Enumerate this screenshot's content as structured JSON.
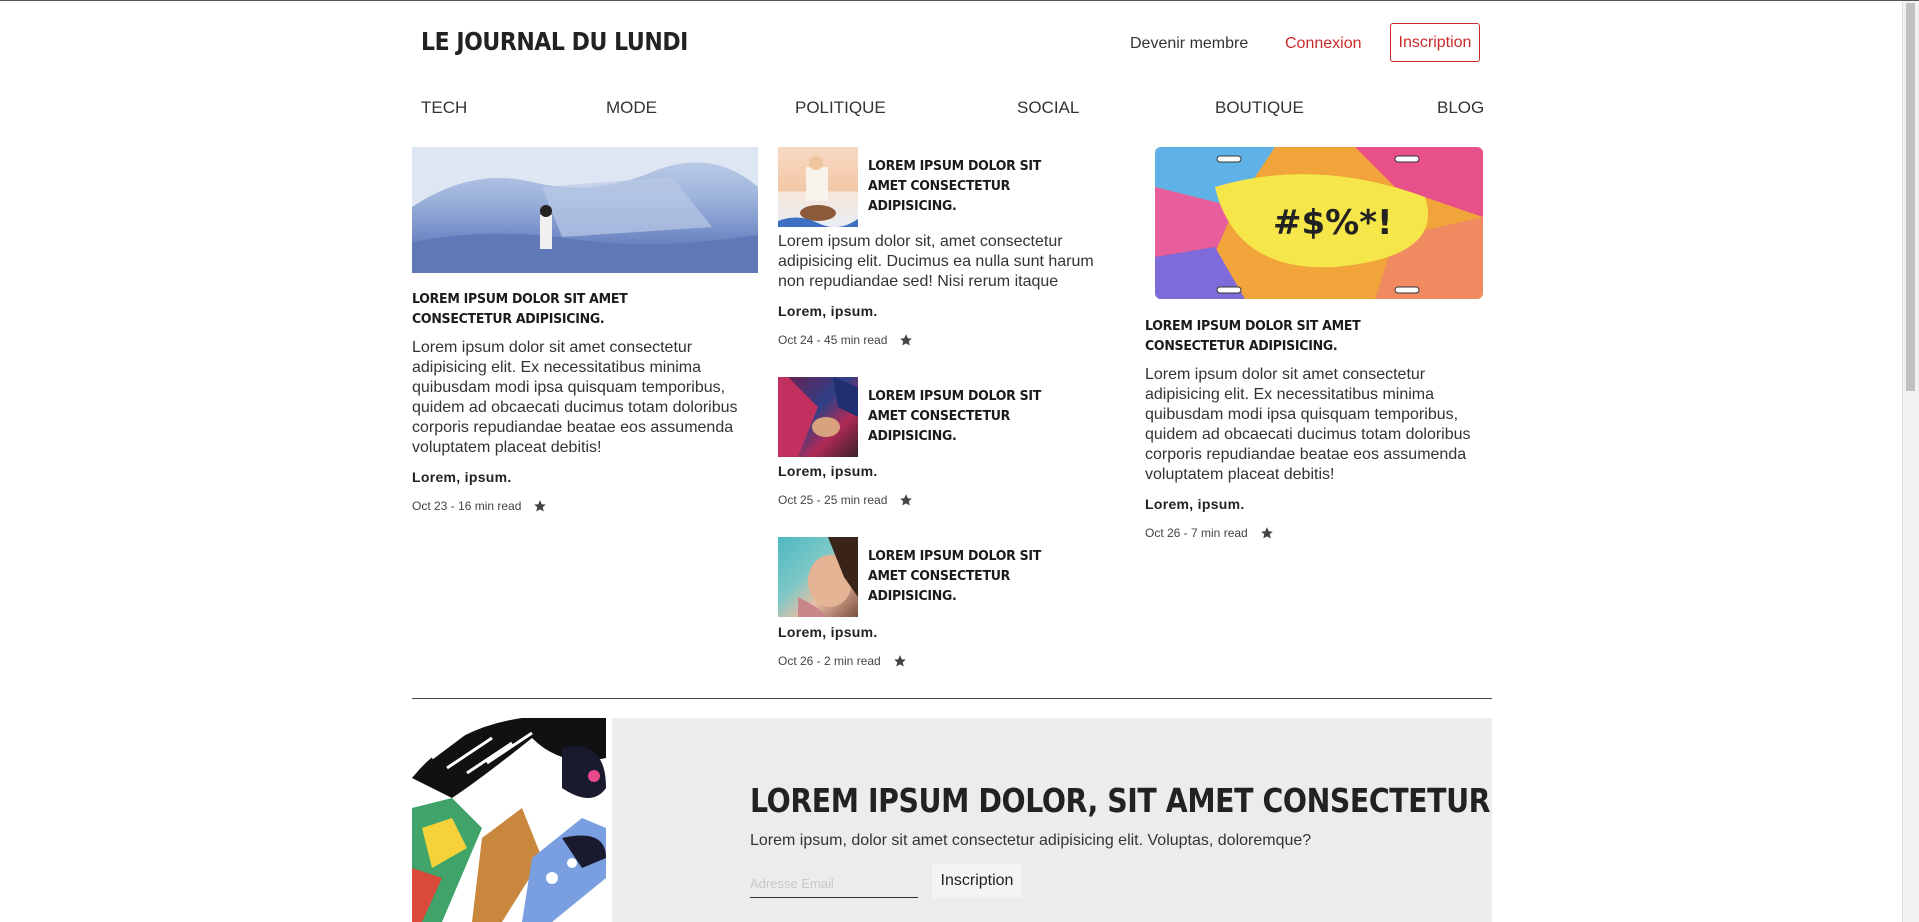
{
  "header": {
    "brand": "LE JOURNAL DU LUNDI",
    "member_link": "Devenir membre",
    "login_link": "Connexion",
    "signup_button": "Inscription"
  },
  "nav": [
    "TECH",
    "MODE",
    "POLITIQUE",
    "SOCIAL",
    "BOUTIQUE",
    "BLOG"
  ],
  "articles": {
    "left": {
      "title": "Lorem ipsum dolor sit amet consectetur adipisicing.",
      "excerpt": "Lorem ipsum dolor sit amet consectetur adipisicing elit. Ex necessitatibus minima quibusdam modi ipsa quisquam temporibus, quidem ad obcaecati ducimus totam doloribus corporis repudiandae beatae eos assumenda voluptatem placeat debitis!",
      "author": "Lorem, ipsum.",
      "meta": "Oct 23 - 16 min read"
    },
    "middle": [
      {
        "title": "Lorem ipsum dolor sit amet consectetur adipisicing.",
        "excerpt": "Lorem ipsum dolor sit, amet consectetur adipisicing elit. Ducimus ea nulla sunt harum non repudiandae sed! Nisi rerum itaque",
        "author": "Lorem, ipsum.",
        "meta": "Oct 24 - 45 min read"
      },
      {
        "title": "Lorem ipsum dolor sit amet consectetur adipisicing.",
        "author": "Lorem, ipsum.",
        "meta": "Oct 25 - 25 min read"
      },
      {
        "title": "Lorem ipsum dolor sit amet consectetur adipisicing.",
        "author": "Lorem, ipsum.",
        "meta": "Oct 26 - 2 min read"
      }
    ],
    "right": {
      "title": "Lorem ipsum dolor sit amet consectetur adipisicing.",
      "excerpt": "Lorem ipsum dolor sit amet consectetur adipisicing elit. Ex necessitatibus minima quibusdam modi ipsa quisquam temporibus, quidem ad obcaecati ducimus totam doloribus corporis repudiandae beatae eos assumenda voluptatem placeat debitis!",
      "author": "Lorem, ipsum.",
      "meta": "Oct 26 - 7 min read",
      "plate_text": "#$%*!"
    }
  },
  "promo": {
    "title": "LOREM IPSUM DOLOR, SIT AMET CONSECTETUR",
    "subtitle": "Lorem ipsum, dolor sit amet consectetur adipisicing elit. Voluptas, doloremque?",
    "email_placeholder": "Adresse Email",
    "button": "Inscription"
  },
  "colors": {
    "accent": "#cc2a2a",
    "promo_bg": "#ececec",
    "star": "#444444"
  },
  "icons": {
    "bookmark": "star-icon"
  }
}
